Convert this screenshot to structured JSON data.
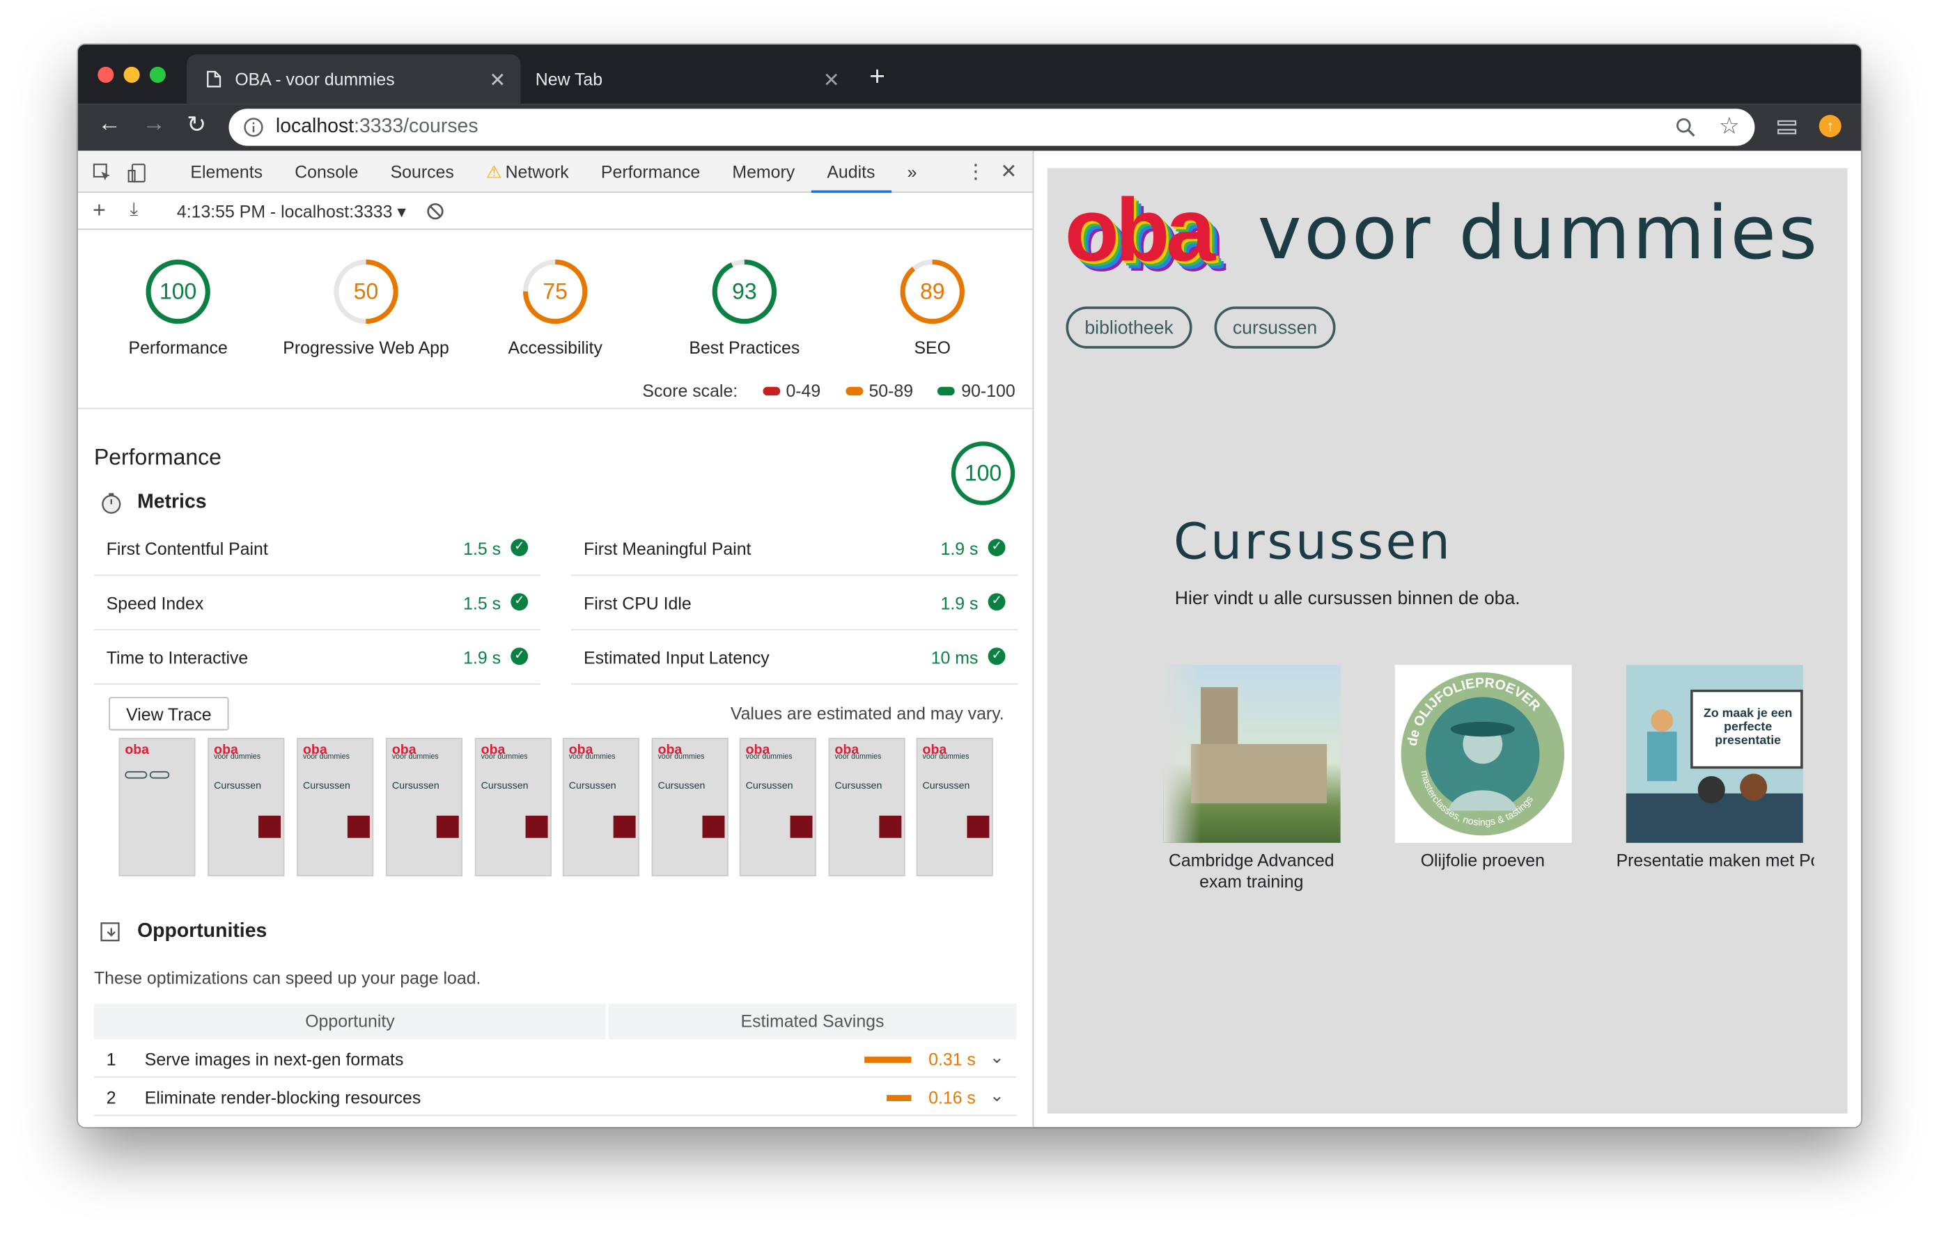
{
  "browser": {
    "active_tab_title": "OBA - voor dummies",
    "inactive_tab_title": "New Tab",
    "address": {
      "host": "localhost",
      "rest": ":3333/courses"
    }
  },
  "devtools": {
    "tabs": [
      "Elements",
      "Console",
      "Sources",
      "Network",
      "Performance",
      "Memory",
      "Audits"
    ],
    "active_tab": "Audits",
    "report_label": "4:13:55 PM - localhost:3333",
    "gauges": [
      {
        "score": 100,
        "label": "Performance",
        "color": "#0b8043"
      },
      {
        "score": 50,
        "label": "Progressive Web App",
        "color": "#e67700"
      },
      {
        "score": 75,
        "label": "Accessibility",
        "color": "#e67700"
      },
      {
        "score": 93,
        "label": "Best Practices",
        "color": "#0b8043"
      },
      {
        "score": 89,
        "label": "SEO",
        "color": "#e67700"
      }
    ],
    "score_scale": {
      "label": "Score scale:",
      "ranges": [
        {
          "range": "0-49",
          "color": "#c5221f"
        },
        {
          "range": "50-89",
          "color": "#e67700"
        },
        {
          "range": "90-100",
          "color": "#0b8043"
        }
      ]
    },
    "performance": {
      "title": "Performance",
      "score": 100,
      "metrics_title": "Metrics",
      "metrics_left": [
        {
          "label": "First Contentful Paint",
          "value": "1.5 s"
        },
        {
          "label": "Speed Index",
          "value": "1.5 s"
        },
        {
          "label": "Time to Interactive",
          "value": "1.9 s"
        }
      ],
      "metrics_right": [
        {
          "label": "First Meaningful Paint",
          "value": "1.9 s"
        },
        {
          "label": "First CPU Idle",
          "value": "1.9 s"
        },
        {
          "label": "Estimated Input Latency",
          "value": "10 ms"
        }
      ],
      "view_trace": "View Trace",
      "estimated_note": "Values are estimated and may vary.",
      "thumb_logo": "oba",
      "thumb_caption": "voor dummies",
      "thumb_heading": "Cursussen"
    },
    "opportunities": {
      "title": "Opportunities",
      "description": "These optimizations can speed up your page load.",
      "col_opportunity": "Opportunity",
      "col_savings": "Estimated Savings",
      "rows": [
        {
          "n": "1",
          "label": "Serve images in next-gen formats",
          "savings": "0.31 s",
          "bar_fraction": 1.0
        },
        {
          "n": "2",
          "label": "Eliminate render-blocking resources",
          "savings": "0.16 s",
          "bar_fraction": 0.52
        }
      ]
    }
  },
  "site": {
    "logo": "oba",
    "tagline": "voor dummies",
    "nav": [
      "bibliotheek",
      "cursussen"
    ],
    "heading": "Cursussen",
    "intro": "Hier vindt u alle cursussen binnen de oba.",
    "courses": [
      {
        "title": "Cambridge Advanced exam training"
      },
      {
        "title": "Olijfolie proeven",
        "badge_text": "de OLIJFOLIEPROEVER",
        "badge_sub": "masterclasses, nosings & tastings"
      },
      {
        "title": "Presentatie maken met PowerPoint",
        "poster_text": "Zo maak je een perfecte presentatie"
      }
    ]
  }
}
